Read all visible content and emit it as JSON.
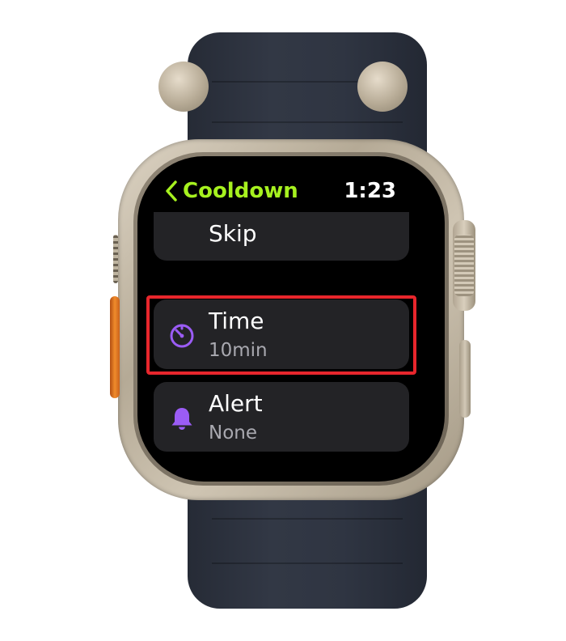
{
  "header": {
    "back_label": "Cooldown",
    "time": "1:23"
  },
  "list": {
    "items": [
      {
        "title": "Skip"
      },
      {
        "title": "Time",
        "value": "10min",
        "icon": "timer-icon"
      },
      {
        "title": "Alert",
        "value": "None",
        "icon": "bell-icon"
      }
    ]
  },
  "colors": {
    "accent_green": "#a6f11f",
    "icon_purple": "#9b5cf5",
    "highlight_red": "#e8262c",
    "row_background": "#232326",
    "secondary_text": "#a9a9b0"
  }
}
